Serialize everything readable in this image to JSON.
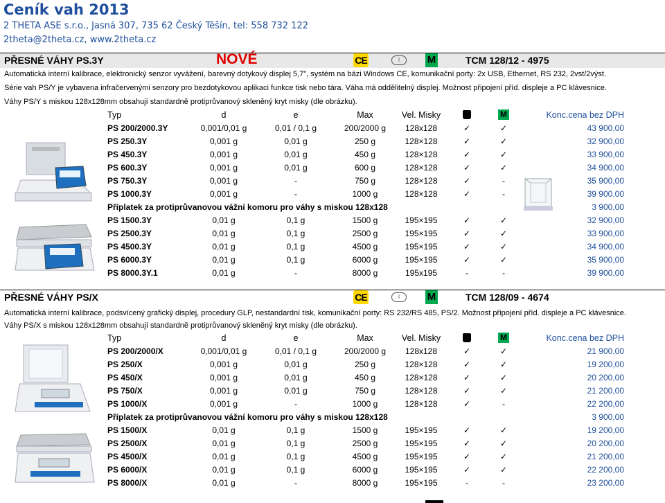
{
  "header": {
    "title": "Ceník vah 2013",
    "line1": "2 THETA ASE s.r.o., Jasná 307, 735 62 Český Těšín, tel: 558 732 122",
    "line2": "2theta@2theta.cz, www.2theta.cz"
  },
  "colors": {
    "brand_blue": "#1f4e9c",
    "new_red": "#e00000",
    "m_green": "#00a84f",
    "ce_yellow": "#ffd800"
  },
  "icons": [
    "ce-mark-icon",
    "oval-mark-icon",
    "m-legal-icon",
    "weight-icon",
    "checkmark-icon"
  ],
  "section1": {
    "title": "PŘESNÉ VÁHY  PS.3Y",
    "new_label": "NOVÉ",
    "ce": "CE",
    "oval": "I",
    "m": "M",
    "tcm": "TCM 128/12 - 4975",
    "desc1": "Automatická interní kalibrace, elektronický senzor vyvážení, barevný dotykový displej 5,7\", systém na bázi Windows CE, komunikační porty: 2x USB, Ethernet, RS 232, 2vst/2výst.",
    "desc2": "Série vah PS/Y je vybavena infračervenými senzory pro bezdotykovou aplikaci funkce tisk nebo tára. Váha má oddělitelný displej. Možnost připojení příd. displeje a PC klávesnice.",
    "desc3": "Váhy PS/Y s miskou 128x128mm obsahují standardně protiprůvanový skleněný kryt misky (dle obrázku).",
    "headers": {
      "typ": "Typ",
      "d": "d",
      "e": "e",
      "max": "Max",
      "vel": "Vel. Misky",
      "m": "M",
      "price": "Konc.cena bez DPH"
    },
    "rows_a": [
      {
        "typ": "PS 200/2000.3Y",
        "d": "0,001/0,01 g",
        "e": "0,01 / 0,1 g",
        "max": "200/2000 g",
        "vel": "128x128",
        "w": "✓",
        "m": "✓",
        "price": "43 900,00"
      },
      {
        "typ": "PS 250.3Y",
        "d": "0,001 g",
        "e": "0,01 g",
        "max": "250 g",
        "vel": "128×128",
        "w": "✓",
        "m": "✓",
        "price": "32 900,00"
      },
      {
        "typ": "PS 450.3Y",
        "d": "0,001 g",
        "e": "0,01 g",
        "max": "450 g",
        "vel": "128×128",
        "w": "✓",
        "m": "✓",
        "price": "33 900,00"
      },
      {
        "typ": "PS 600.3Y",
        "d": "0,001 g",
        "e": "0,01 g",
        "max": "600 g",
        "vel": "128×128",
        "w": "✓",
        "m": "✓",
        "price": "34 900,00"
      },
      {
        "typ": "PS 750.3Y",
        "d": "0,001 g",
        "e": "-",
        "max": "750 g",
        "vel": "128×128",
        "w": "✓",
        "m": "-",
        "price": "35 900,00"
      },
      {
        "typ": "PS 1000.3Y",
        "d": "0,001 g",
        "e": "-",
        "max": "1000 g",
        "vel": "128×128",
        "w": "✓",
        "m": "-",
        "price": "39 900,00"
      }
    ],
    "surcharge": {
      "label": "Příplatek za protiprůvanovou vážní komoru pro váhy s miskou 128x128",
      "price": "3 900,00"
    },
    "rows_b": [
      {
        "typ": "PS 1500.3Y",
        "d": "0,01 g",
        "e": "0,1 g",
        "max": "1500 g",
        "vel": "195×195",
        "w": "✓",
        "m": "✓",
        "price": "32 900,00"
      },
      {
        "typ": "PS 2500.3Y",
        "d": "0,01 g",
        "e": "0,1 g",
        "max": "2500 g",
        "vel": "195×195",
        "w": "✓",
        "m": "✓",
        "price": "33 900,00"
      },
      {
        "typ": "PS 4500.3Y",
        "d": "0,01 g",
        "e": "0,1 g",
        "max": "4500 g",
        "vel": "195×195",
        "w": "✓",
        "m": "✓",
        "price": "34 900,00"
      },
      {
        "typ": "PS 6000.3Y",
        "d": "0,01 g",
        "e": "0,1 g",
        "max": "6000 g",
        "vel": "195×195",
        "w": "✓",
        "m": "✓",
        "price": "35 900,00"
      },
      {
        "typ": "PS 8000.3Y.1",
        "d": "0,01 g",
        "e": "-",
        "max": "8000 g",
        "vel": "195x195",
        "w": "-",
        "m": "-",
        "price": "39 900,00"
      }
    ]
  },
  "section2": {
    "title": "PŘESNÉ VÁHY  PS/X",
    "ce": "CE",
    "oval": "I",
    "m": "M",
    "tcm": "TCM 128/09 - 4674",
    "desc1": "Automatická interní kalibrace, podsvícený grafický displej, procedury GLP, nestandardní tisk, komunikační porty: RS 232/RS 485, PS/2. Možnost připojení příd. displeje a PC klávesnice.",
    "desc2": "Váhy PS/X s miskou 128x128mm obsahují standardně protiprůvanový skleněný kryt misky (dle obrázku).",
    "headers": {
      "typ": "Typ",
      "d": "d",
      "e": "e",
      "max": "Max",
      "vel": "Vel. Misky",
      "m": "M",
      "price": "Konc.cena bez DPH"
    },
    "rows_a": [
      {
        "typ": "PS 200/2000/X",
        "d": "0,001/0,01 g",
        "e": "0,01 / 0,1 g",
        "max": "200/2000 g",
        "vel": "128x128",
        "w": "✓",
        "m": "✓",
        "price": "21 900,00"
      },
      {
        "typ": "PS 250/X",
        "d": "0,001 g",
        "e": "0,01 g",
        "max": "250 g",
        "vel": "128×128",
        "w": "✓",
        "m": "✓",
        "price": "19 200,00"
      },
      {
        "typ": "PS 450/X",
        "d": "0,001 g",
        "e": "0,01 g",
        "max": "450 g",
        "vel": "128×128",
        "w": "✓",
        "m": "✓",
        "price": "20 200,00"
      },
      {
        "typ": "PS 750/X",
        "d": "0,001 g",
        "e": "0,01 g",
        "max": "750 g",
        "vel": "128×128",
        "w": "✓",
        "m": "✓",
        "price": "21 200,00"
      },
      {
        "typ": "PS 1000/X",
        "d": "0,001 g",
        "e": "-",
        "max": "1000 g",
        "vel": "128×128",
        "w": "✓",
        "m": "-",
        "price": "22 200,00"
      }
    ],
    "surcharge": {
      "label": "Příplatek za protiprůvanovou vážní komoru pro váhy s miskou 128x128",
      "price": "3 900,00"
    },
    "rows_b": [
      {
        "typ": "PS 1500/X",
        "d": "0,01 g",
        "e": "0,1 g",
        "max": "1500 g",
        "vel": "195×195",
        "w": "✓",
        "m": "✓",
        "price": "19 200,00"
      },
      {
        "typ": "PS 2500/X",
        "d": "0,01 g",
        "e": "0,1 g",
        "max": "2500 g",
        "vel": "195×195",
        "w": "✓",
        "m": "✓",
        "price": "20 200,00"
      },
      {
        "typ": "PS 4500/X",
        "d": "0,01 g",
        "e": "0,1 g",
        "max": "4500 g",
        "vel": "195×195",
        "w": "✓",
        "m": "✓",
        "price": "21 200,00"
      },
      {
        "typ": "PS 6000/X",
        "d": "0,01 g",
        "e": "0,1 g",
        "max": "6000 g",
        "vel": "195×195",
        "w": "✓",
        "m": "✓",
        "price": "22 200,00"
      },
      {
        "typ": "PS 8000/X",
        "d": "0,01 g",
        "e": "-",
        "max": "8000 g",
        "vel": "195×195",
        "w": "-",
        "m": "-",
        "price": "23 200,00"
      }
    ]
  }
}
